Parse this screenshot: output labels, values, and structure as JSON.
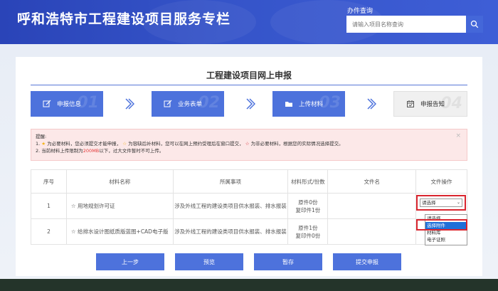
{
  "header": {
    "title": "呼和浩特市工程建设项目服务专栏",
    "search_label": "办件查询",
    "search_placeholder": "请输入项目名称查询"
  },
  "panel": {
    "title": "工程建设项目网上申报"
  },
  "steps": [
    {
      "label": "申报信息",
      "num": "01",
      "icon": "edit-icon",
      "state": "active"
    },
    {
      "label": "业务表单",
      "num": "02",
      "icon": "edit-icon",
      "state": "active"
    },
    {
      "label": "上传材料",
      "num": "03",
      "icon": "folder-icon",
      "state": "active"
    },
    {
      "label": "申报告知",
      "num": "04",
      "icon": "calendar-icon",
      "state": "inactive"
    }
  ],
  "alert": {
    "heading": "提醒:",
    "line1_prefix": "1.",
    "line1_a": "为必要材料，您必须提交才能申报，",
    "line1_b": "为容缺后补材料，您可以在网上预约受理后在窗口提交，",
    "line1_c": "为非必要材料，根据您的实际情况选择提交。",
    "line2_a": "2. 当前材料上传限制为",
    "line2_limit": "200MB",
    "line2_b": "以下，过大文件暂时不可上传。",
    "close": "×",
    "star_filled": "★",
    "star_hollow": "☆"
  },
  "table": {
    "headers": [
      "序号",
      "材料名称",
      "所属事项",
      "材料形式/份数",
      "文件名",
      "文件操作"
    ],
    "rows": [
      {
        "index": "1",
        "name": "☆ 用地规划许可证",
        "matter": "涉及外线工程的建设类项目供水报装、排水报装",
        "form_line1": "原件0份",
        "form_line2": "复印件1份",
        "filename": ""
      },
      {
        "index": "2",
        "name": "☆ 给排水设计图纸质版蓝图+CAD电子版",
        "matter": "涉及外线工程的建设类项目供水报装、排水报装",
        "form_line1": "原件1份",
        "form_line2": "复印件0份",
        "filename": ""
      }
    ]
  },
  "select": {
    "selected": "请选择",
    "options": [
      "请选择",
      "选择附件",
      "材料库",
      "电子证照"
    ],
    "highlighted_option": "选择附件"
  },
  "buttons": {
    "prev": "上一步",
    "preview": "预览",
    "save": "暂存",
    "submit": "提交申报"
  },
  "colors": {
    "header_blue": "#3554c9",
    "accent_blue": "#4d72dc",
    "alert_red": "#e23a3a",
    "highlight_red": "#d9252f",
    "star_gold": "#f3b317"
  }
}
